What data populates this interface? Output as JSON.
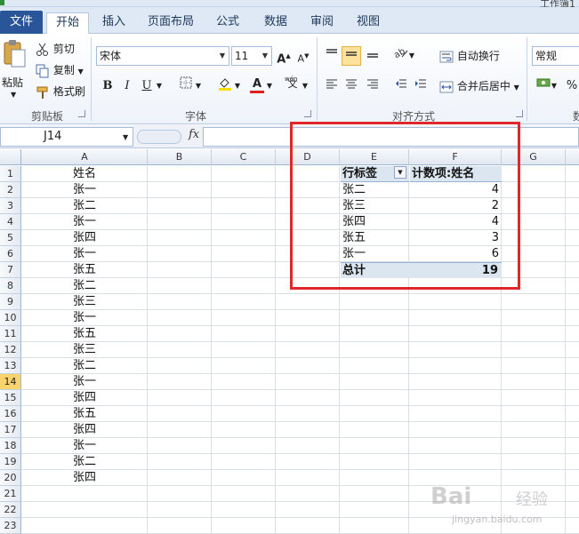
{
  "window": {
    "title": "工作簿1"
  },
  "tabs": [
    "文件",
    "开始",
    "插入",
    "页面布局",
    "公式",
    "数据",
    "审阅",
    "视图"
  ],
  "ribbon": {
    "clipboard": {
      "paste": "粘贴",
      "cut": "剪切",
      "copy": "复制",
      "format_painter": "格式刷",
      "label": "剪贴板"
    },
    "font": {
      "font_name": "宋体",
      "font_size": "11",
      "bold": "B",
      "italic": "I",
      "underline": "U",
      "label": "字体"
    },
    "alignment": {
      "wrap_text": "自动换行",
      "merge_center": "合并后居中",
      "label": "对齐方式"
    },
    "number": {
      "format": "常规",
      "percent": "%",
      "label_partial": "数"
    }
  },
  "formula_bar": {
    "name_box": "J14",
    "fx": "fx",
    "content": ""
  },
  "grid": {
    "columns": [
      "A",
      "B",
      "C",
      "D",
      "E",
      "F",
      "G"
    ],
    "rows": [
      "1",
      "2",
      "3",
      "4",
      "5",
      "6",
      "7",
      "8",
      "9",
      "10",
      "11",
      "12",
      "13",
      "14",
      "15",
      "16",
      "17",
      "18",
      "19",
      "20",
      "21",
      "22",
      "23"
    ],
    "active_row": "14",
    "column_a": [
      "姓名",
      "张一",
      "张二",
      "张一",
      "张四",
      "张一",
      "张五",
      "张二",
      "张三",
      "张一",
      "张五",
      "张三",
      "张二",
      "张一",
      "张四",
      "张五",
      "张四",
      "张一",
      "张二",
      "张四"
    ]
  },
  "pivot": {
    "row_label_header": "行标签",
    "value_header": "计数项:姓名",
    "rows": [
      {
        "label": "张二",
        "value": "4"
      },
      {
        "label": "张三",
        "value": "2"
      },
      {
        "label": "张四",
        "value": "4"
      },
      {
        "label": "张五",
        "value": "3"
      },
      {
        "label": "张一",
        "value": "6"
      }
    ],
    "total_label": "总计",
    "total_value": "19"
  },
  "watermark": {
    "logo": "Bai",
    "text": "经验",
    "url": "jingyan.baidu.com"
  }
}
